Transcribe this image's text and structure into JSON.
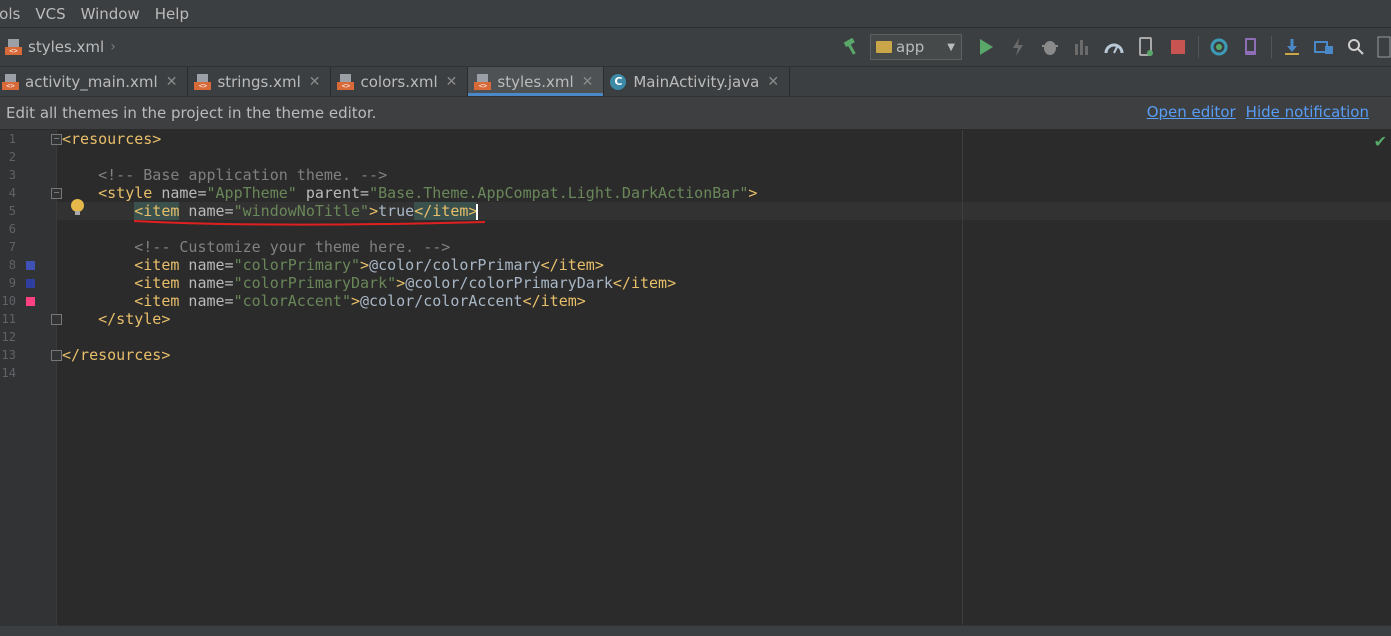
{
  "menu": [
    "ools",
    "VCS",
    "Window",
    "Help"
  ],
  "breadcrumb": {
    "file": "styles.xml"
  },
  "toolbar": {
    "run_config": "app",
    "icons": [
      "build-hammer-icon",
      "run-icon",
      "apply-changes-icon",
      "debug-icon",
      "attach-debugger-icon",
      "profile-icon",
      "device-icon",
      "stop-icon",
      "sync-icon",
      "avd-icon",
      "sdk-icon",
      "project-structure-icon",
      "search-icon"
    ]
  },
  "tabs": [
    {
      "label": "activity_main.xml",
      "type": "xml"
    },
    {
      "label": "strings.xml",
      "type": "xml"
    },
    {
      "label": "colors.xml",
      "type": "xml"
    },
    {
      "label": "styles.xml",
      "type": "xml",
      "active": true
    },
    {
      "label": "MainActivity.java",
      "type": "java"
    }
  ],
  "notification": {
    "text": "Edit all themes in the project in the theme editor.",
    "open_editor": "Open editor",
    "hide": "Hide notification"
  },
  "line_numbers": [
    "1",
    "2",
    "3",
    "4",
    "5",
    "6",
    "7",
    "8",
    "9",
    "10",
    "11",
    "12",
    "13",
    "14"
  ],
  "gutter_swatches": {
    "line8": "#3f51b5",
    "line9": "#303f9f",
    "line10": "#ff4081"
  },
  "code": {
    "l1_tag": "<resources>",
    "l3_comment": "<!-- Base application theme. -->",
    "l4_open": "<style",
    "l4_attr1": " name=",
    "l4_val1": "\"AppTheme\"",
    "l4_attr2": " parent=",
    "l4_val2": "\"Base.Theme.AppCompat.Light.DarkActionBar\"",
    "l4_close": ">",
    "l5_open": "<item",
    "l5_attr": " name=",
    "l5_val": "\"windowNoTitle\"",
    "l5_gt": ">",
    "l5_text": "true",
    "l5_close": "</item>",
    "l7_comment": "<!-- Customize your theme here. -->",
    "l8_open": "<item",
    "l8_attr": " name=",
    "l8_val": "\"colorPrimary\"",
    "l8_gt": ">",
    "l8_text": "@color/colorPrimary",
    "l8_close": "</item>",
    "l9_open": "<item",
    "l9_attr": " name=",
    "l9_val": "\"colorPrimaryDark\"",
    "l9_gt": ">",
    "l9_text": "@color/colorPrimaryDark",
    "l9_close": "</item>",
    "l10_open": "<item",
    "l10_attr": " name=",
    "l10_val": "\"colorAccent\"",
    "l10_gt": ">",
    "l10_text": "@color/colorAccent",
    "l10_close": "</item>",
    "l11_close": "</style>",
    "l13_close": "</resources>"
  }
}
